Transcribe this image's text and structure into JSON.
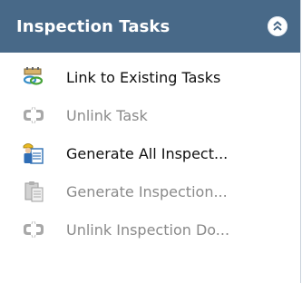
{
  "panel": {
    "title": "Inspection Tasks",
    "collapse_icon": "double-chevron-up-icon"
  },
  "items": [
    {
      "label": "Link to Existing Tasks",
      "icon": "link-tasks-icon",
      "enabled": true
    },
    {
      "label": "Unlink Task",
      "icon": "unlink-icon",
      "enabled": false
    },
    {
      "label": "Generate All Inspect...",
      "icon": "generate-all-icon",
      "enabled": true
    },
    {
      "label": "Generate Inspection...",
      "icon": "generate-document-icon",
      "enabled": false
    },
    {
      "label": "Unlink Inspection Do...",
      "icon": "unlink-icon",
      "enabled": false
    }
  ],
  "colors": {
    "header_bg": "#486988",
    "enabled_text": "#101010",
    "disabled_text": "#8a8a8a"
  }
}
